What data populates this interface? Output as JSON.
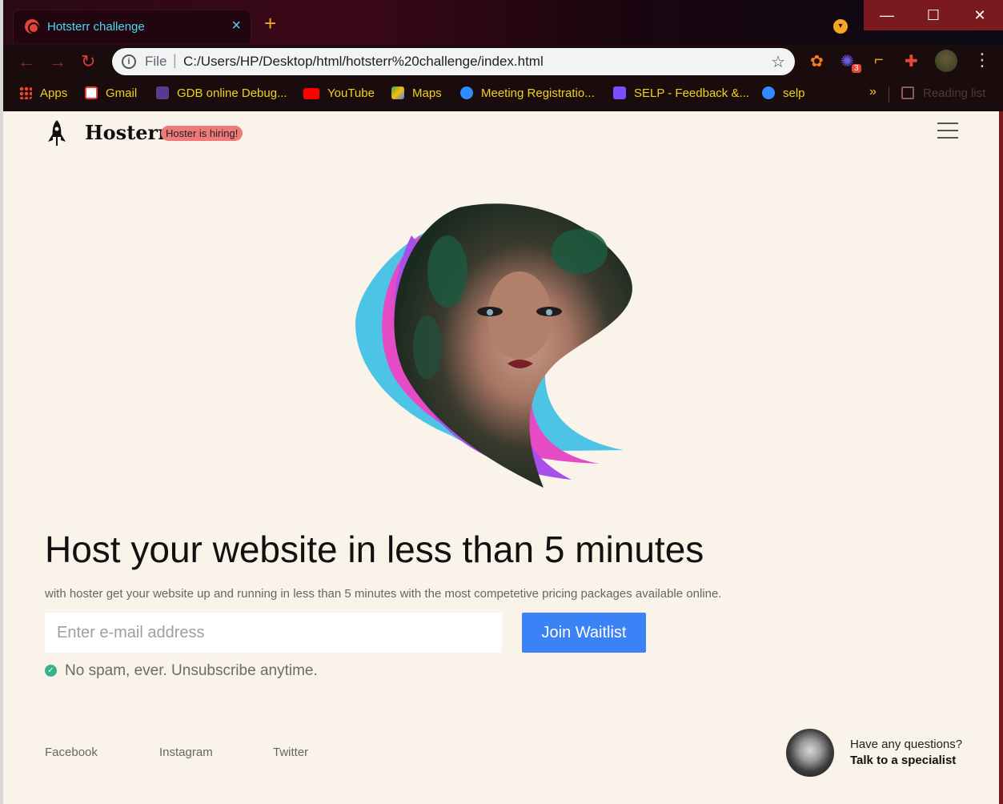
{
  "browser": {
    "tab_title": "Hotsterr challenge",
    "tab_close": "×",
    "new_tab": "+",
    "omnibox_scheme": "File",
    "omnibox_url": "C:/Users/HP/Desktop/html/hotsterr%20challenge/index.html",
    "extension_badge": "3",
    "bookmarks": [
      {
        "label": "Apps"
      },
      {
        "label": "Gmail"
      },
      {
        "label": "GDB online Debug..."
      },
      {
        "label": "YouTube"
      },
      {
        "label": "Maps"
      },
      {
        "label": "Meeting Registratio..."
      },
      {
        "label": "SELP - Feedback &..."
      },
      {
        "label": "selp"
      }
    ],
    "overflow": "»",
    "reading_list": "Reading list"
  },
  "header": {
    "brand": "Hosterr",
    "badge": "Hoster is hiring!"
  },
  "hero": {
    "headline": "Host your website in less than 5 minutes",
    "subtext": "with hoster get your website up and running in less than 5 minutes with the most competetive pricing packages available online.",
    "email_placeholder": "Enter e-mail address",
    "cta": "Join Waitlist",
    "note": "No spam, ever. Unsubscribe anytime."
  },
  "footer": {
    "links": [
      "Facebook",
      "Instagram",
      "Twitter"
    ],
    "question": "Have any questions?",
    "specialist": "Talk to a specialist"
  },
  "colors": {
    "page_bg": "#f9f3e9",
    "accent": "#3b82f6",
    "badge": "#f07a7a",
    "check": "#38b28a"
  }
}
